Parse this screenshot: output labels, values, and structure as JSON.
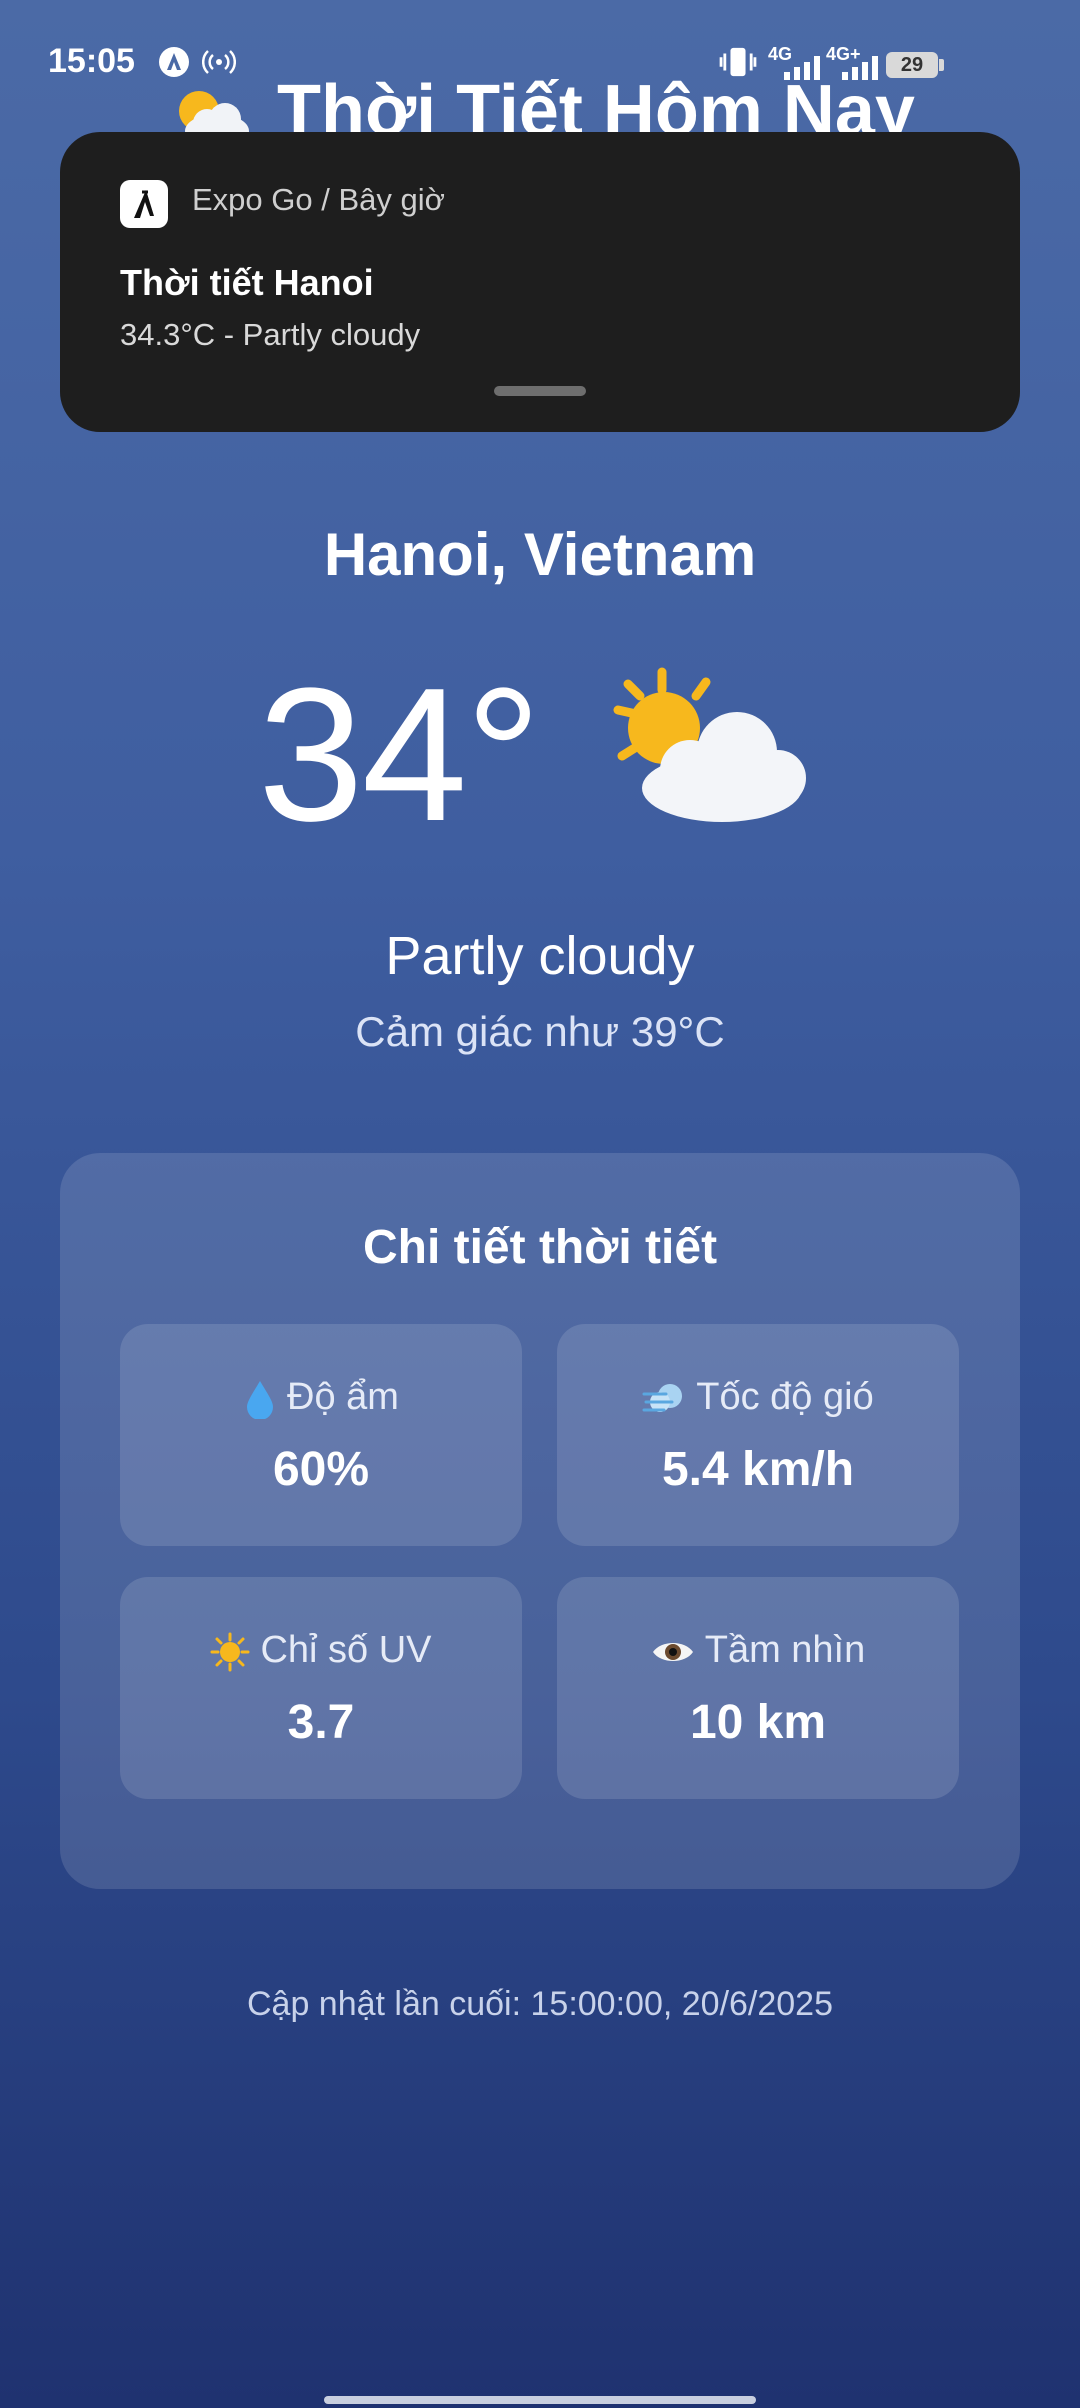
{
  "status_bar": {
    "time": "15:05",
    "network_1": "4G",
    "network_2": "4G+",
    "battery": "29"
  },
  "app": {
    "title": "Thời Tiết Hôm Nay"
  },
  "notification": {
    "app_name": "Expo Go",
    "separator": "/",
    "time": "Bây giờ",
    "title": "Thời tiết Hanoi",
    "body": "34.3°C - Partly cloudy"
  },
  "weather": {
    "city": "Hanoi, Vietnam",
    "temperature": "34°",
    "condition": "Partly cloudy",
    "feels_like": "Cảm giác như 39°C",
    "icon": "sun-behind-cloud-icon"
  },
  "details": {
    "title": "Chi tiết thời tiết",
    "items": [
      {
        "label": "Độ ẩm",
        "value": "60%",
        "icon": "droplet-icon"
      },
      {
        "label": "Tốc độ gió",
        "value": "5.4 km/h",
        "icon": "wind-icon"
      },
      {
        "label": "Chỉ số UV",
        "value": "3.7",
        "icon": "sun-icon"
      },
      {
        "label": "Tầm nhìn",
        "value": "10 km",
        "icon": "eye-icon"
      }
    ]
  },
  "footer": {
    "updated": "Cập nhật lần cuối: 15:00:00, 20/6/2025"
  },
  "colors": {
    "bg_top": "#4b6aa6",
    "bg_bottom": "#1f3270",
    "notification_bg": "#1e1e1e",
    "sun": "#f7b81d"
  }
}
